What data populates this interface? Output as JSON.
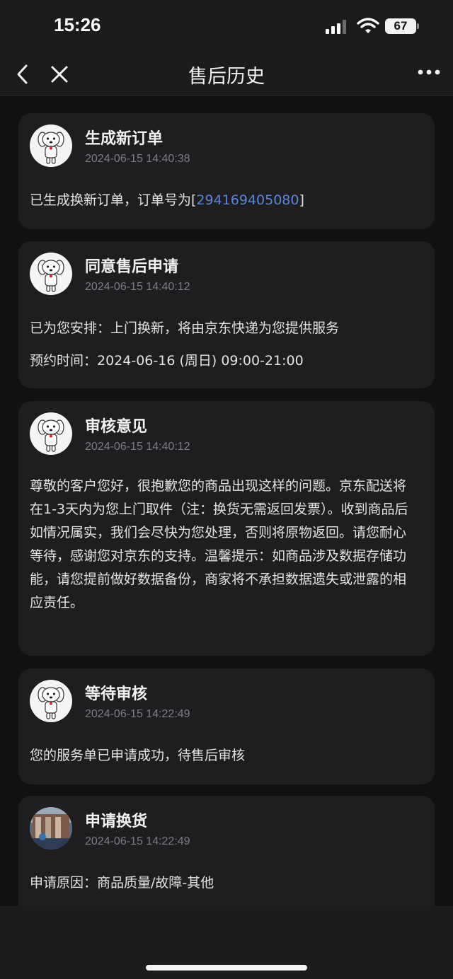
{
  "status_bar": {
    "time": "15:26",
    "battery": "67"
  },
  "nav": {
    "title": "售后历史"
  },
  "records": [
    {
      "title": "生成新订单",
      "time": "2024-06-15 14:40:38",
      "text_prefix": "已生成换新订单，订单号为[",
      "order_no": "294169405080",
      "text_suffix": "]"
    },
    {
      "title": "同意售后申请",
      "time": "2024-06-15 14:40:12",
      "line1": "已为您安排：上门换新，将由京东快递为您提供服务",
      "line2": "预约时间：2024-06-16 (周日) 09:00-21:00"
    },
    {
      "title": "审核意见",
      "time": "2024-06-15 14:40:12",
      "text": "尊敬的客户您好，很抱歉您的商品出现这样的问题。京东配送将\n在1-3天内为您上门取件（注：换货无需返回发票）。收到商品后\n如情况属实，我们会尽快为您处理，否则将原物返回。请您耐心\n等待，感谢您对京东的支持。温馨提示：如商品涉及数据存储功\n能，请您提前做好数据备份，商家将不承担数据遗失或泄露的相\n应责任。"
    },
    {
      "title": "等待审核",
      "time": "2024-06-15 14:22:49",
      "text": "您的服务单已申请成功，待售后审核"
    },
    {
      "title": "申请换货",
      "time": "2024-06-15 14:22:49",
      "line1": "申请原因：商品质量/故障-其他"
    }
  ],
  "colors": {
    "background": "#111111",
    "card": "#1e1e20",
    "link": "#5b85d9",
    "muted": "#7d7d82"
  },
  "icons": {
    "back": "chevron-left-icon",
    "close": "close-icon",
    "more": "more-dots-icon",
    "avatar": "jd-mascot-icon"
  }
}
